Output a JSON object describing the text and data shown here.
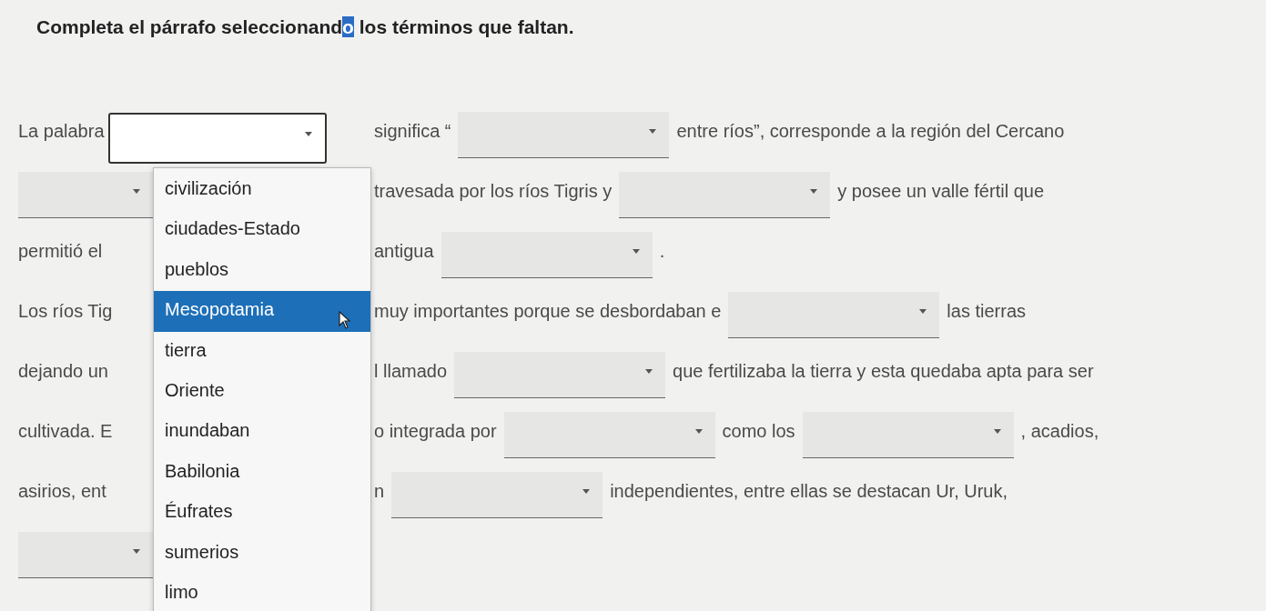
{
  "title": {
    "parts": [
      {
        "text": "Completa el párrafo seleccionand",
        "highlighted": false
      },
      {
        "text": "o",
        "highlighted": true
      },
      {
        "text": " los términos que faltan.",
        "highlighted": false
      }
    ]
  },
  "lines": [
    {
      "left": [
        {
          "kind": "text",
          "text": "La palabra"
        },
        {
          "kind": "open"
        }
      ],
      "right": [
        {
          "kind": "text",
          "text": "significa “"
        },
        {
          "kind": "blank"
        },
        {
          "kind": "text",
          "text": "entre ríos”, corresponde a la región del Cercano"
        }
      ]
    },
    {
      "left": [
        {
          "kind": "blank"
        }
      ],
      "right": [
        {
          "kind": "text",
          "text": "travesada por los ríos Tigris y"
        },
        {
          "kind": "blank"
        },
        {
          "kind": "text",
          "text": "y posee un valle fértil que"
        }
      ]
    },
    {
      "left": [
        {
          "kind": "text",
          "text": "permitió el"
        }
      ],
      "right": [
        {
          "kind": "text",
          "text": "antigua"
        },
        {
          "kind": "blank"
        },
        {
          "kind": "text",
          "text": "."
        }
      ]
    },
    {
      "left": [
        {
          "kind": "text",
          "text": "Los ríos Tig"
        }
      ],
      "right": [
        {
          "kind": "text",
          "text": "muy importantes porque se desbordaban e"
        },
        {
          "kind": "blank"
        },
        {
          "kind": "text",
          "text": "las tierras"
        }
      ]
    },
    {
      "left": [
        {
          "kind": "text",
          "text": "dejando un"
        }
      ],
      "right": [
        {
          "kind": "text",
          "text": "l llamado"
        },
        {
          "kind": "blank"
        },
        {
          "kind": "text",
          "text": "que fertilizaba la tierra y esta quedaba apta para ser"
        }
      ]
    },
    {
      "left": [
        {
          "kind": "text",
          "text": "cultivada. E"
        }
      ],
      "right": [
        {
          "kind": "text",
          "text": "o integrada por"
        },
        {
          "kind": "blank"
        },
        {
          "kind": "text",
          "text": "como los"
        },
        {
          "kind": "blank"
        },
        {
          "kind": "text",
          "text": ", acadios,"
        }
      ]
    },
    {
      "left": [
        {
          "kind": "text",
          "text": "asirios, ent"
        }
      ],
      "right": [
        {
          "kind": "text",
          "text": "n"
        },
        {
          "kind": "blank"
        },
        {
          "kind": "text",
          "text": "independientes, entre ellas se destacan Ur, Uruk,"
        }
      ]
    },
    {
      "left": [
        {
          "kind": "blank"
        }
      ]
    }
  ],
  "menu": [
    {
      "label": "civilización",
      "selected": false
    },
    {
      "label": "ciudades-Estado",
      "selected": false
    },
    {
      "label": "pueblos",
      "selected": false
    },
    {
      "label": "Mesopotamia",
      "selected": true
    },
    {
      "label": "tierra",
      "selected": false
    },
    {
      "label": "Oriente",
      "selected": false
    },
    {
      "label": "inundaban",
      "selected": false
    },
    {
      "label": "Babilonia",
      "selected": false
    },
    {
      "label": "Éufrates",
      "selected": false
    },
    {
      "label": "sumerios",
      "selected": false
    },
    {
      "label": "limo",
      "selected": false
    }
  ]
}
